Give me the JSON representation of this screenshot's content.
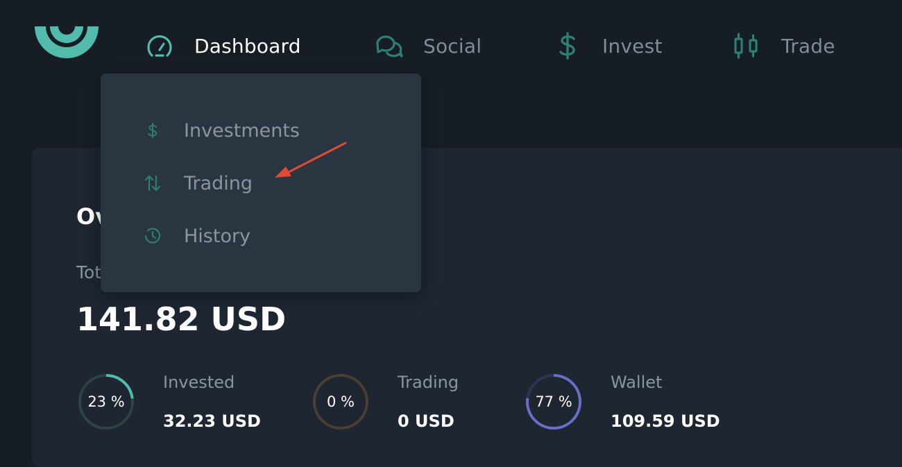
{
  "colors": {
    "accent": "#53bbab",
    "accent_dim": "#2e7e72",
    "background": "#161d25",
    "card": "#1d2631",
    "dropdown": "#2a3542",
    "annotation_arrow": "#e34a33",
    "ring_invested": "#53bbab",
    "ring_trading": "#8c6f48",
    "ring_wallet": "#6a6ec7"
  },
  "nav": {
    "items": [
      {
        "label": "Dashboard",
        "icon": "speedometer-icon",
        "active": true
      },
      {
        "label": "Social",
        "icon": "chat-bubbles-icon",
        "active": false
      },
      {
        "label": "Invest",
        "icon": "dollar-icon",
        "active": false
      },
      {
        "label": "Trade",
        "icon": "candlestick-icon",
        "active": false
      }
    ]
  },
  "dropdown": {
    "items": [
      {
        "label": "Investments",
        "icon": "dollar-icon"
      },
      {
        "label": "Trading",
        "icon": "up-down-arrows-icon"
      },
      {
        "label": "History",
        "icon": "clock-icon"
      }
    ]
  },
  "overview": {
    "title": "Ov",
    "total_label": "Tot",
    "total_value": "141.82 USD",
    "stats": [
      {
        "percent_text": "23 %",
        "percent": 23,
        "label": "Invested",
        "value": "32.23 USD"
      },
      {
        "percent_text": "0 %",
        "percent": 0,
        "label": "Trading",
        "value": "0 USD"
      },
      {
        "percent_text": "77 %",
        "percent": 77,
        "label": "Wallet",
        "value": "109.59 USD"
      }
    ]
  }
}
